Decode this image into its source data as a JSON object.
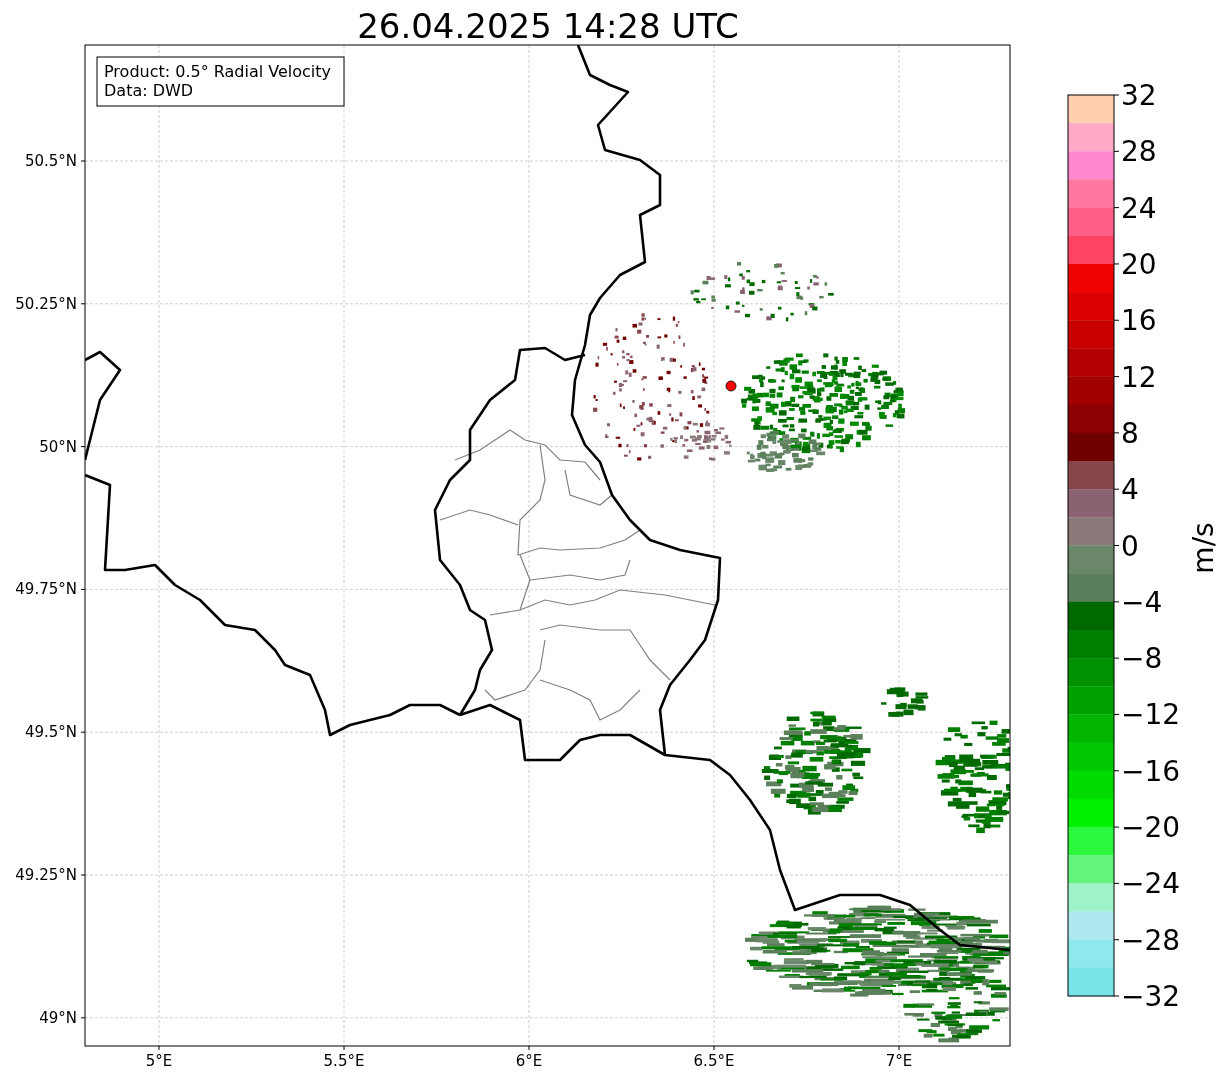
{
  "title": "26.04.2025 14:28 UTC",
  "info_box": [
    "Product: 0.5° Radial Velocity",
    "Data: DWD"
  ],
  "lat_ticks": [
    "50.5°N",
    "50.25°N",
    "50°N",
    "49.75°N",
    "49.5°N",
    "49.25°N",
    "49°N"
  ],
  "lon_ticks": [
    "5°E",
    "5.5°E",
    "6°E",
    "6.5°E",
    "7°E"
  ],
  "colorbar": {
    "label": "m/s",
    "ticks": [
      "32",
      "28",
      "24",
      "20",
      "16",
      "12",
      "8",
      "4",
      "0",
      "−4",
      "−8",
      "−12",
      "−16",
      "−20",
      "−24",
      "−28",
      "−32"
    ],
    "bands": [
      {
        "color": "#ffcfb0"
      },
      {
        "color": "#ffa8c8"
      },
      {
        "color": "#ff88d0"
      },
      {
        "color": "#ff78a0"
      },
      {
        "color": "#ff6088"
      },
      {
        "color": "#ff4466"
      },
      {
        "color": "#f00000"
      },
      {
        "color": "#dc0000"
      },
      {
        "color": "#c80000"
      },
      {
        "color": "#b40000"
      },
      {
        "color": "#a00000"
      },
      {
        "color": "#8b0000"
      },
      {
        "color": "#700000"
      },
      {
        "color": "#87464c"
      },
      {
        "color": "#8a6372"
      },
      {
        "color": "#8b7878"
      },
      {
        "color": "#6a876a"
      },
      {
        "color": "#5a7f5a"
      },
      {
        "color": "#006a00"
      },
      {
        "color": "#007e00"
      },
      {
        "color": "#009000"
      },
      {
        "color": "#00a200"
      },
      {
        "color": "#00b400"
      },
      {
        "color": "#00c800"
      },
      {
        "color": "#00dc00"
      },
      {
        "color": "#00f000"
      },
      {
        "color": "#2df840"
      },
      {
        "color": "#62f47c"
      },
      {
        "color": "#9ef4c8"
      },
      {
        "color": "#ade9ef"
      },
      {
        "color": "#8ee9ed"
      },
      {
        "color": "#79e4e8"
      }
    ]
  }
}
